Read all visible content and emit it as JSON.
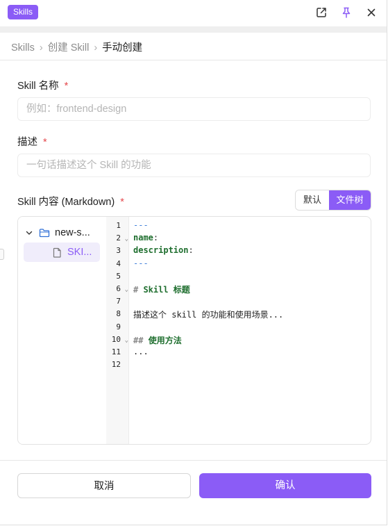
{
  "topbar": {
    "badge": "Skills",
    "icons": [
      "external-link-icon",
      "pin-icon",
      "close-icon"
    ],
    "pin_color": "#8b5cf6"
  },
  "breadcrumb": {
    "items": [
      "Skills",
      "创建 Skill",
      "手动创建"
    ],
    "separator": "›"
  },
  "form": {
    "name_label": "Skill 名称",
    "name_placeholder": "例如：frontend-design",
    "desc_label": "描述",
    "desc_placeholder": "一句话描述这个 Skill 的功能",
    "content_label": "Skill 内容 (Markdown)",
    "required_mark": "*",
    "view_toggle": {
      "options": [
        "默认",
        "文件树"
      ],
      "selected": "文件树"
    }
  },
  "file_tree": {
    "folder": "new-s...",
    "file": "SKI..."
  },
  "code": {
    "line_numbers": [
      "1",
      "2",
      "3",
      "4",
      "5",
      "6",
      "7",
      "8",
      "9",
      "10",
      "11",
      "12"
    ],
    "foldable_lines": [
      2,
      6,
      10
    ],
    "lines": [
      {
        "parts": [
          {
            "t": "---",
            "c": "c-dash"
          }
        ]
      },
      {
        "parts": [
          {
            "t": "name",
            "c": "c-key"
          },
          {
            "t": ":",
            "c": "c-punc"
          }
        ]
      },
      {
        "parts": [
          {
            "t": "description",
            "c": "c-key"
          },
          {
            "t": ":",
            "c": "c-punc"
          }
        ]
      },
      {
        "parts": [
          {
            "t": "---",
            "c": "c-dash"
          }
        ]
      },
      {
        "parts": []
      },
      {
        "parts": [
          {
            "t": "# ",
            "c": "c-hmark"
          },
          {
            "t": "Skill 标题",
            "c": "c-h"
          }
        ]
      },
      {
        "parts": []
      },
      {
        "parts": [
          {
            "t": "描述这个 skill 的功能和使用场景...",
            "c": "c-text"
          }
        ]
      },
      {
        "parts": []
      },
      {
        "parts": [
          {
            "t": "## ",
            "c": "c-hmark"
          },
          {
            "t": "使用方法",
            "c": "c-h"
          }
        ]
      },
      {
        "parts": [
          {
            "t": "...",
            "c": "c-text"
          }
        ]
      },
      {
        "parts": []
      }
    ]
  },
  "footer": {
    "cancel_label": "取消",
    "confirm_label": "确认"
  },
  "colors": {
    "accent": "#8b5cf6",
    "required": "#e5484d"
  }
}
